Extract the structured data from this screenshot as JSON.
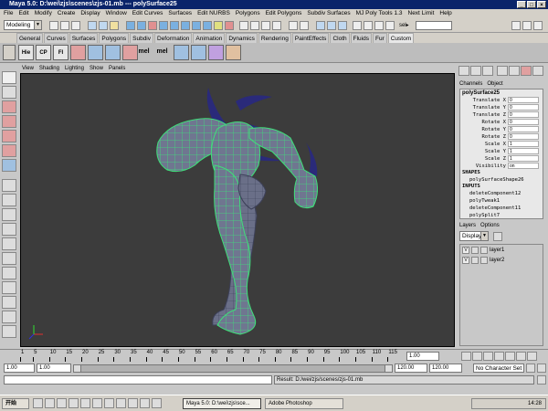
{
  "window": {
    "title": "Maya 5.0: D:\\wei\\zjs\\scenes\\zjs-01.mb  ---  polySurface25"
  },
  "menu": [
    "File",
    "Edit",
    "Modify",
    "Create",
    "Display",
    "Window",
    "Edit Curves",
    "Surfaces",
    "Edit NURBS",
    "Polygons",
    "Edit Polygons",
    "Subdiv Surfaces",
    "MJ Poly Tools 1.3",
    "Next Limit",
    "Help"
  ],
  "statusline": {
    "mode": "Modeling",
    "sel_label": "sel▸"
  },
  "shelf_tabs": [
    "General",
    "Curves",
    "Surfaces",
    "Polygons",
    "Subdiv",
    "Deformation",
    "Animation",
    "Dynamics",
    "Rendering",
    "PaintEffects",
    "Cloth",
    "Fluids",
    "Fur",
    "Custom"
  ],
  "shelf_icons": [
    "Hie",
    "CP",
    "FI",
    "",
    "",
    "",
    "",
    "mel",
    "mel",
    "",
    "",
    "",
    ""
  ],
  "viewport_menu": [
    "View",
    "Shading",
    "Lighting",
    "Show",
    "Panels"
  ],
  "channelbox": {
    "tabs": [
      "Channels",
      "Object"
    ],
    "object_name": "polySurface25",
    "channels": [
      {
        "name": "Translate X",
        "value": "0"
      },
      {
        "name": "Translate Y",
        "value": "0"
      },
      {
        "name": "Translate Z",
        "value": "0"
      },
      {
        "name": "Rotate X",
        "value": "0"
      },
      {
        "name": "Rotate Y",
        "value": "0"
      },
      {
        "name": "Rotate Z",
        "value": "0"
      },
      {
        "name": "Scale X",
        "value": "1"
      },
      {
        "name": "Scale Y",
        "value": "1"
      },
      {
        "name": "Scale Z",
        "value": "1"
      },
      {
        "name": "Visibility",
        "value": "on"
      }
    ],
    "shapes_label": "SHAPES",
    "shape": "polySurfaceShape26",
    "inputs_label": "INPUTS",
    "inputs": [
      "deleteComponent12",
      "polyTweak1",
      "deleteComponent11",
      "polySplit7"
    ]
  },
  "layers": {
    "tabs": [
      "Layers",
      "Options"
    ],
    "display": "Display",
    "items": [
      {
        "visible": "V",
        "name": "layer1"
      },
      {
        "visible": "V",
        "name": "layer2"
      }
    ]
  },
  "timeline": {
    "ticks": [
      "1",
      "5",
      "10",
      "15",
      "20",
      "25",
      "30",
      "35",
      "40",
      "45",
      "50",
      "55",
      "60",
      "65",
      "70",
      "75",
      "80",
      "85",
      "90",
      "95",
      "100",
      "105",
      "110",
      "115"
    ],
    "current": "1.00"
  },
  "range": {
    "start": "1.00",
    "inner_start": "1.00",
    "inner_end": "120.00",
    "end": "120.00",
    "character_set": "No Character Set"
  },
  "command": {
    "result": "Result: D:/wei/zjs/scenes/zjs-01.mb"
  },
  "taskbar": {
    "start": "开始",
    "tasks": [
      "Maya 5.0: D:\\wei\\zjs\\sce...",
      "Adobe Photoshop"
    ],
    "clock": "14:28"
  },
  "colors": {
    "viewport_bg": "#3c3c3c",
    "wire": "#3fe07a",
    "shaded": "#6f7690",
    "spikes": "#2a2a7a"
  }
}
